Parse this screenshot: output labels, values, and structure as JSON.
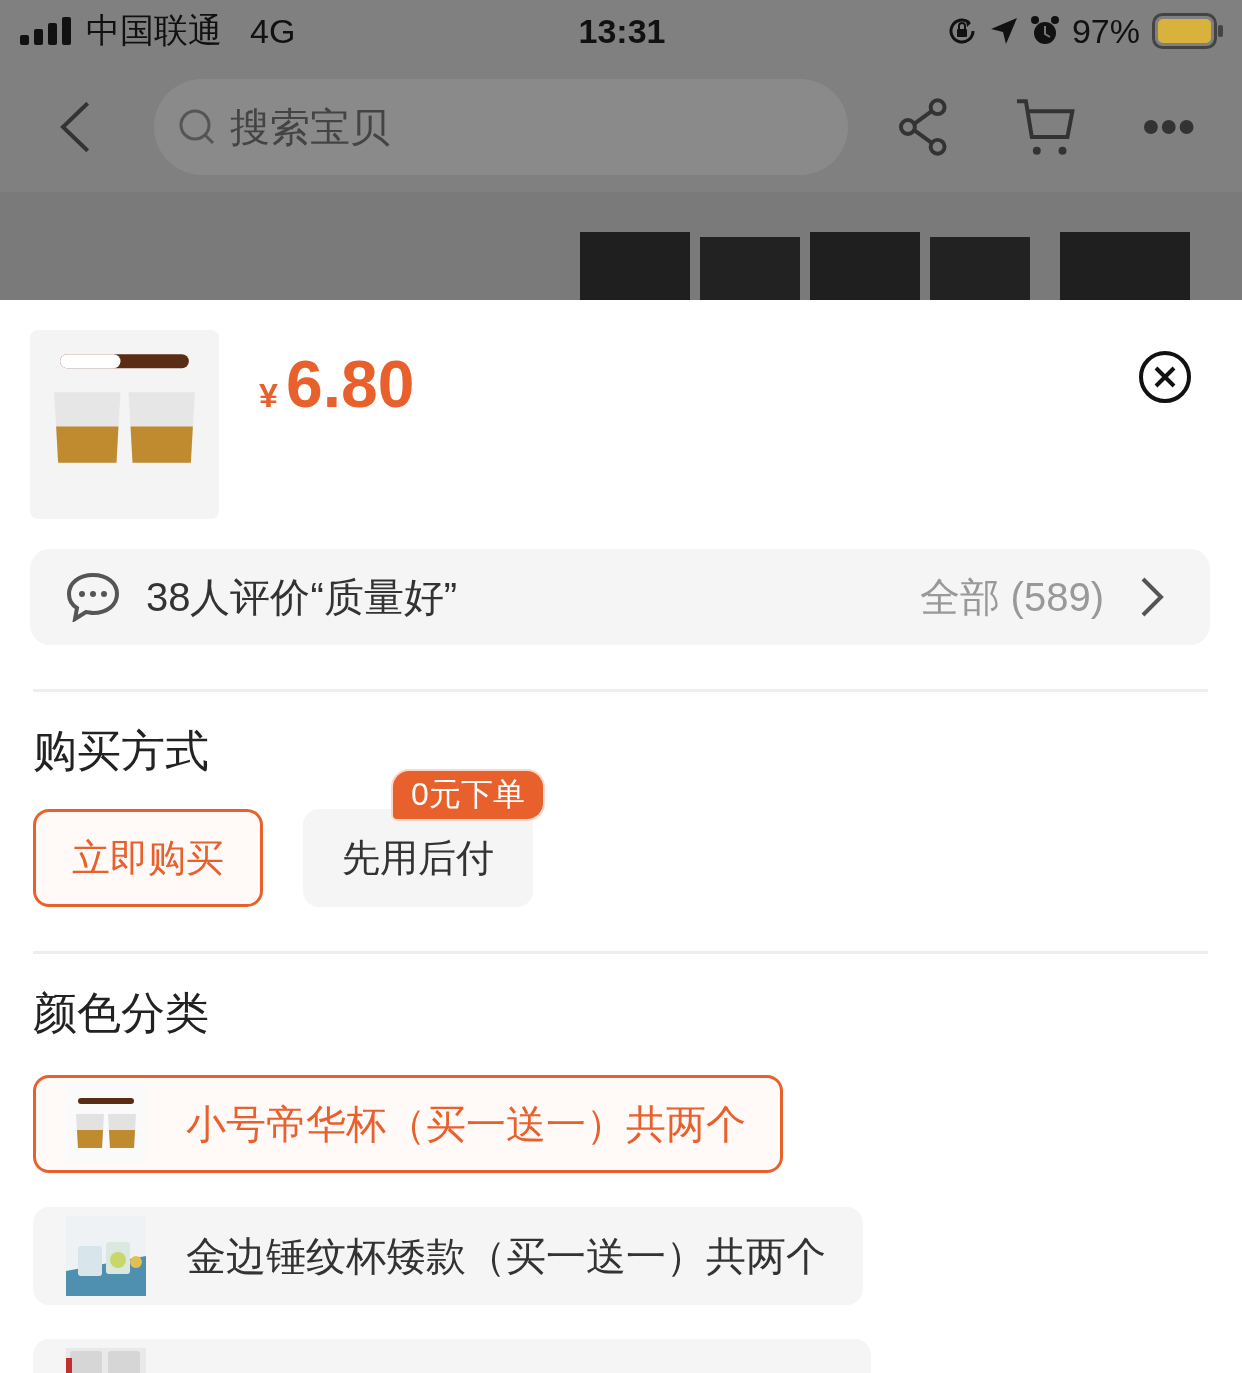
{
  "status_bar": {
    "carrier": "中国联通",
    "network": "4G",
    "time": "13:31",
    "battery": "97%"
  },
  "nav": {
    "search": {
      "placeholder": "搜索宝贝"
    }
  },
  "sheet": {
    "price": {
      "currency": "¥",
      "amount": "6.80"
    },
    "review": {
      "text": "38人评价“质量好”",
      "all": "全部 (589)"
    },
    "purchase": {
      "title": "购买方式",
      "options": [
        {
          "label": "立即购买",
          "selected": true
        },
        {
          "label": "先用后付",
          "selected": false,
          "badge": "0元下单"
        }
      ]
    },
    "color": {
      "title": "颜色分类",
      "options": [
        {
          "label": "小号帝华杯（买一送一）共两个",
          "selected": true
        },
        {
          "label": "金边锤纹杯矮款（买一送一）共两个",
          "selected": false
        },
        {
          "selected": false
        }
      ]
    }
  }
}
